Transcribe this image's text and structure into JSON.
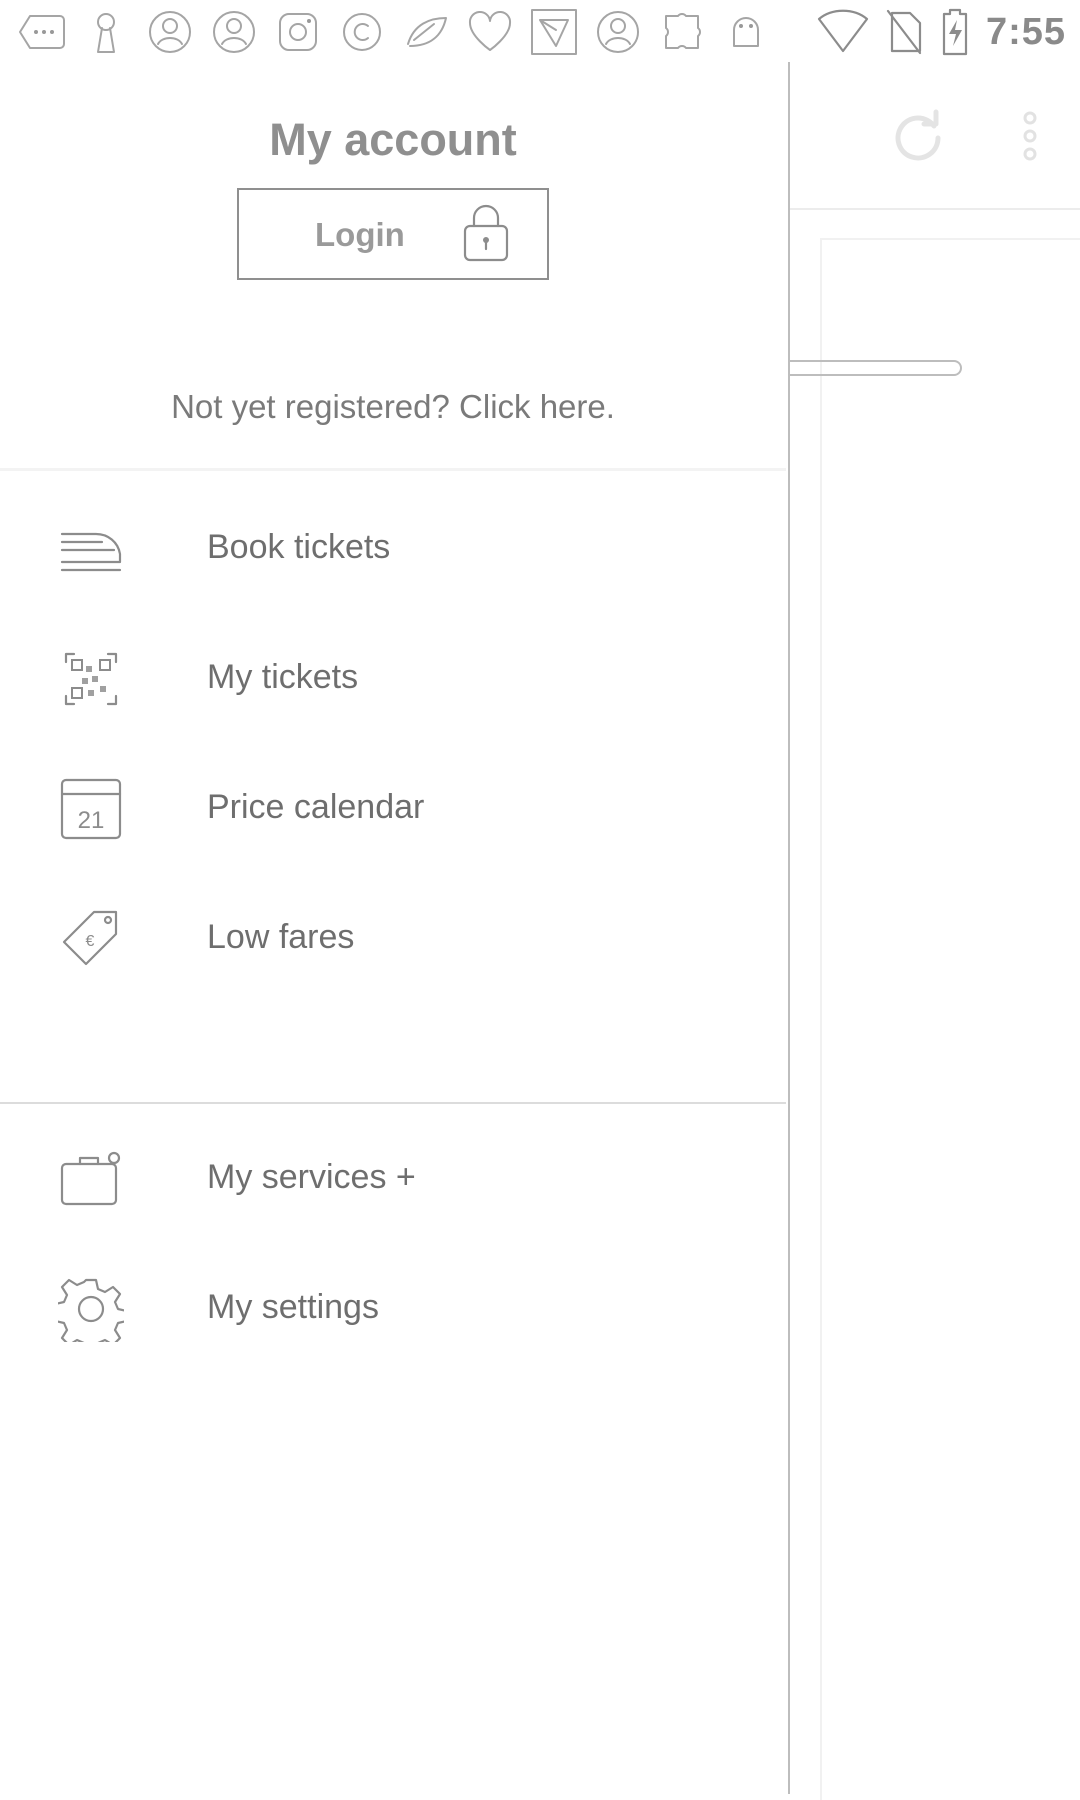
{
  "status_bar": {
    "time": "7:55",
    "notification_icons": [
      "more-horizontal-icon",
      "keyhole-icon",
      "person-circle-icon",
      "person-circle-icon",
      "instagram-icon",
      "copyright-icon",
      "leaf-icon",
      "heart-icon",
      "send-icon",
      "person-circle-icon",
      "puzzle-icon",
      "android-icon"
    ],
    "system_icons": [
      "wifi-icon",
      "no-sim-icon",
      "battery-charging-icon"
    ]
  },
  "drawer": {
    "header": {
      "title": "My account",
      "login_label": "Login",
      "register_text": "Not yet registered? Click here."
    },
    "menu_primary": [
      {
        "label": "Book tickets",
        "icon": "train-icon"
      },
      {
        "label": "My tickets",
        "icon": "qr-code-icon"
      },
      {
        "label": "Price calendar",
        "icon": "calendar-icon",
        "icon_text": "21"
      },
      {
        "label": "Low fares",
        "icon": "price-tag-icon",
        "icon_text": "€"
      }
    ],
    "menu_secondary": [
      {
        "label": "My services +",
        "icon": "briefcase-plus-icon"
      },
      {
        "label": "My settings",
        "icon": "gear-icon"
      }
    ]
  },
  "background_app": {
    "toolbar_icons": [
      "refresh-icon",
      "overflow-menu-icon"
    ]
  }
}
